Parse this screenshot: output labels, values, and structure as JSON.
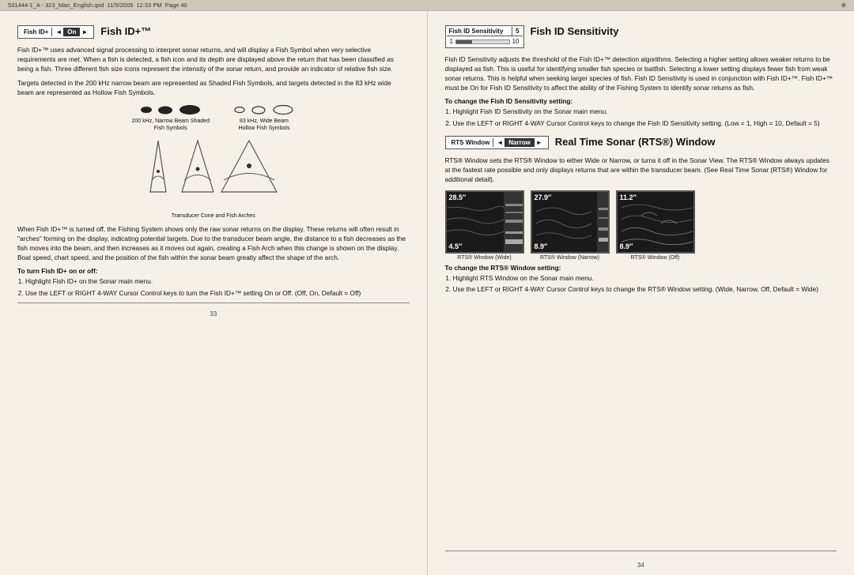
{
  "topbar": {
    "filename": "531444-1_A - 323_Man_English.qxd",
    "date": "11/5/2005",
    "time": "12:33 PM",
    "page_label": "Page  40"
  },
  "left": {
    "widget_fishid": {
      "label": "Fish ID+",
      "value": "On",
      "arrow_left": "◄",
      "arrow_right": "►"
    },
    "section_title": "Fish ID+™",
    "para1": "Fish ID+™ uses advanced signal processing to interpret sonar returns, and will display a Fish Symbol when very selective requirements are met. When a fish is detected, a fish icon and its depth are displayed above the return that has been classified as being a fish. Three different fish size icons represent the intensity of the sonar return, and provide an indicator of relative fish size.",
    "para2": "Targets detected in the 200 kHz narrow beam are represented as Shaded Fish Symbols, and targets detected in the 83 kHz wide beam are represented as Hollow Fish Symbols.",
    "fish_group1_label": "200 kHz, Narrow Beam Shaded\nFish Symbols",
    "fish_group2_label": "83 kHz, Wide Beam\nHollow Fish Symbols",
    "transducer_label": "Transducer Cone and Fish Arches",
    "para3": "When Fish ID+™ is turned off, the Fishing System shows only the raw sonar returns on the display. These returns will often result in \"arches\" forming on the display, indicating potential targets. Due to the transducer beam angle, the distance to a fish decreases as the fish moves into the beam, and then increases as it moves out again, creating a Fish Arch when this change is shown on the display. Boat speed, chart speed, and the position of the fish within the sonar beam greatly affect the shape of the arch.",
    "instruction_heading": "To turn Fish ID+ on or off:",
    "instruction1": "Highlight Fish ID+ on the Sonar main menu.",
    "instruction2": "Use the LEFT or RIGHT 4-WAY Cursor Control keys to turn the Fish ID+™ setting On or Off. (Off, On, Default = Off)",
    "page_number": "33"
  },
  "right": {
    "widget_sensitivity": {
      "label": "Fish ID Sensitivity",
      "value": "5",
      "scale_min": "1",
      "scale_max": "10"
    },
    "section_title": "Fish ID Sensitivity",
    "para1": "Fish ID Sensitivity adjusts the threshold of the Fish ID+™ detection algorithms. Selecting a higher setting allows weaker returns to be displayed as fish. This is useful for identifying smaller fish species or baitfish. Selecting a lower setting displays fewer fish from weak sonar returns. This is helpful when seeking larger species of fish. Fish ID Sensitivity is used in conjunction with Fish ID+™. Fish ID+™ must be On for Fish ID Sensitivity to affect the ability of the Fishing System to identify sonar returns as fish.",
    "instruction_heading": "To change the Fish ID Sensitivity setting:",
    "instruction1": "Highlight Fish ID Sensitivity on the Sonar main menu.",
    "instruction2": "Use the LEFT or RIGHT 4-WAY Cursor Control keys to change the Fish ID Sensitivity setting. (Low = 1, High = 10, Default = 5)",
    "widget_rts": {
      "label": "RTS Window",
      "value": "Narrow",
      "arrow_left": "◄",
      "arrow_right": "►"
    },
    "rts_section_title": "Real Time Sonar (RTS®) Window",
    "rts_para1": "RTS® Window sets the RTS® Window to either Wide or Narrow, or turns it off in the Sonar View. The RTS® Window always updates at the fastest rate possible and only displays returns that are within the transducer beam. (See Real Time Sonar (RTS®) Window for additional detail).",
    "rts_images": [
      {
        "depth_top": "28.5″",
        "depth_bottom": "4.5″",
        "label": "RTS® Window (Wide)"
      },
      {
        "depth_top": "27.9″",
        "depth_bottom": "8.9″",
        "label": "RTS® Window (Narrow)"
      },
      {
        "depth_top": "11.2″",
        "depth_bottom": "8.9″",
        "label": "RTS® Window (Off)"
      }
    ],
    "rts_instruction_heading": "To change the RTS® Window setting:",
    "rts_instruction1": "Highlight RTS Window on the Sonar main menu.",
    "rts_instruction2": "Use the LEFT or RIGHT 4-WAY Cursor Control keys to change the RTS® Window setting. (Wide, Narrow, Off, Default = Wide)",
    "page_number": "34"
  }
}
